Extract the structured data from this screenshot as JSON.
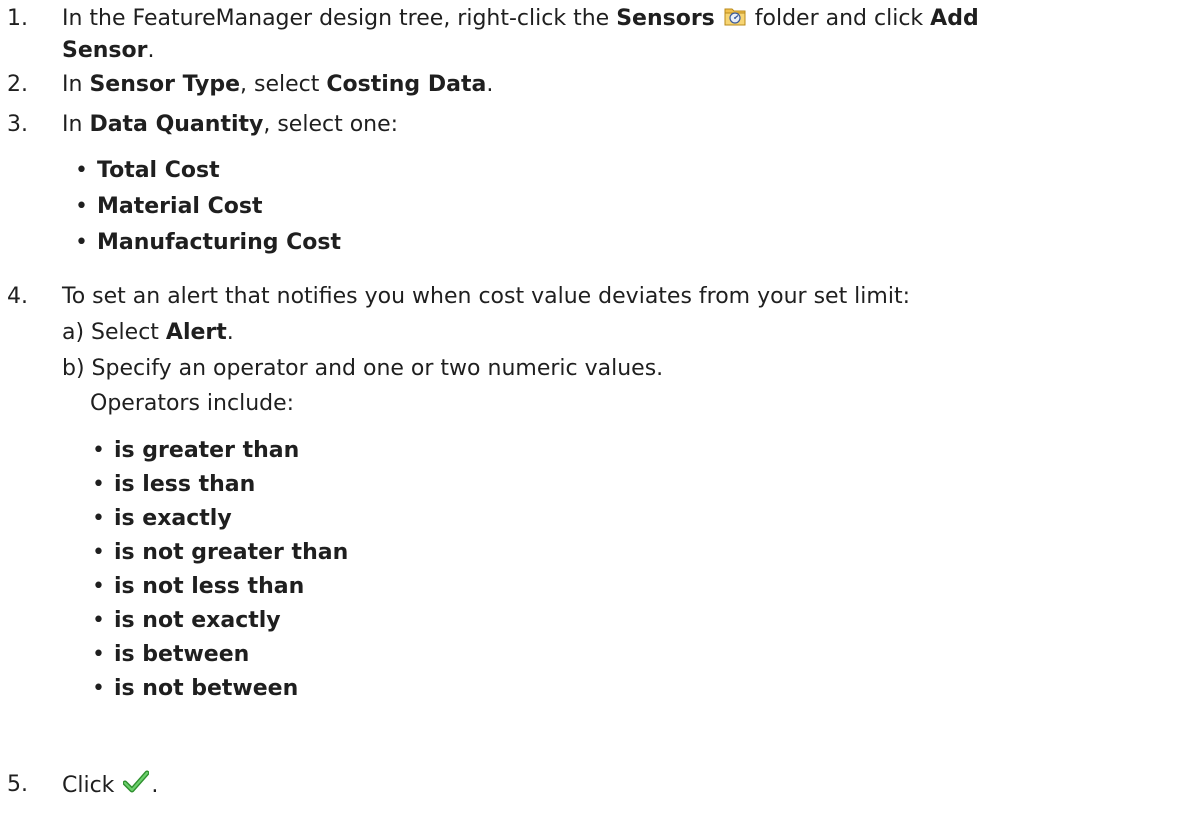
{
  "steps": {
    "s1": {
      "number": "1.",
      "part1": "In the FeatureManager design tree, right-click the ",
      "bold1": "Sensors",
      "icon": "sensors-folder-icon",
      "part2": " folder and click ",
      "bold2": "Add",
      "bold3": "Sensor",
      "part3": "."
    },
    "s2": {
      "number": "2.",
      "part1": "In ",
      "bold1": "Sensor Type",
      "part2": ", select ",
      "bold2": "Costing Data",
      "part3": "."
    },
    "s3": {
      "number": "3.",
      "part1": "In ",
      "bold1": "Data Quantity",
      "part2": ", select one:",
      "options": [
        "Total Cost",
        "Material Cost",
        "Manufacturing Cost"
      ]
    },
    "s4": {
      "number": "4.",
      "intro": "To set an alert that notifies you when cost value deviates from your set limit:",
      "a_prefix": "a) Select ",
      "a_bold": "Alert",
      "a_suffix": ".",
      "b_text": "b) Specify an operator and one or two numeric values.",
      "operators_label": "Operators include:",
      "operators": [
        "is greater than",
        "is less than",
        "is exactly",
        "is not greater than",
        "is not less than",
        "is not exactly",
        "is between",
        "is not between"
      ]
    },
    "s5": {
      "number": "5.",
      "text": "Click ",
      "icon": "checkmark-icon",
      "suffix": "."
    }
  },
  "colors": {
    "text": "#1f1f1f",
    "folder": "#f2c14e",
    "check": "#3ca83c"
  }
}
